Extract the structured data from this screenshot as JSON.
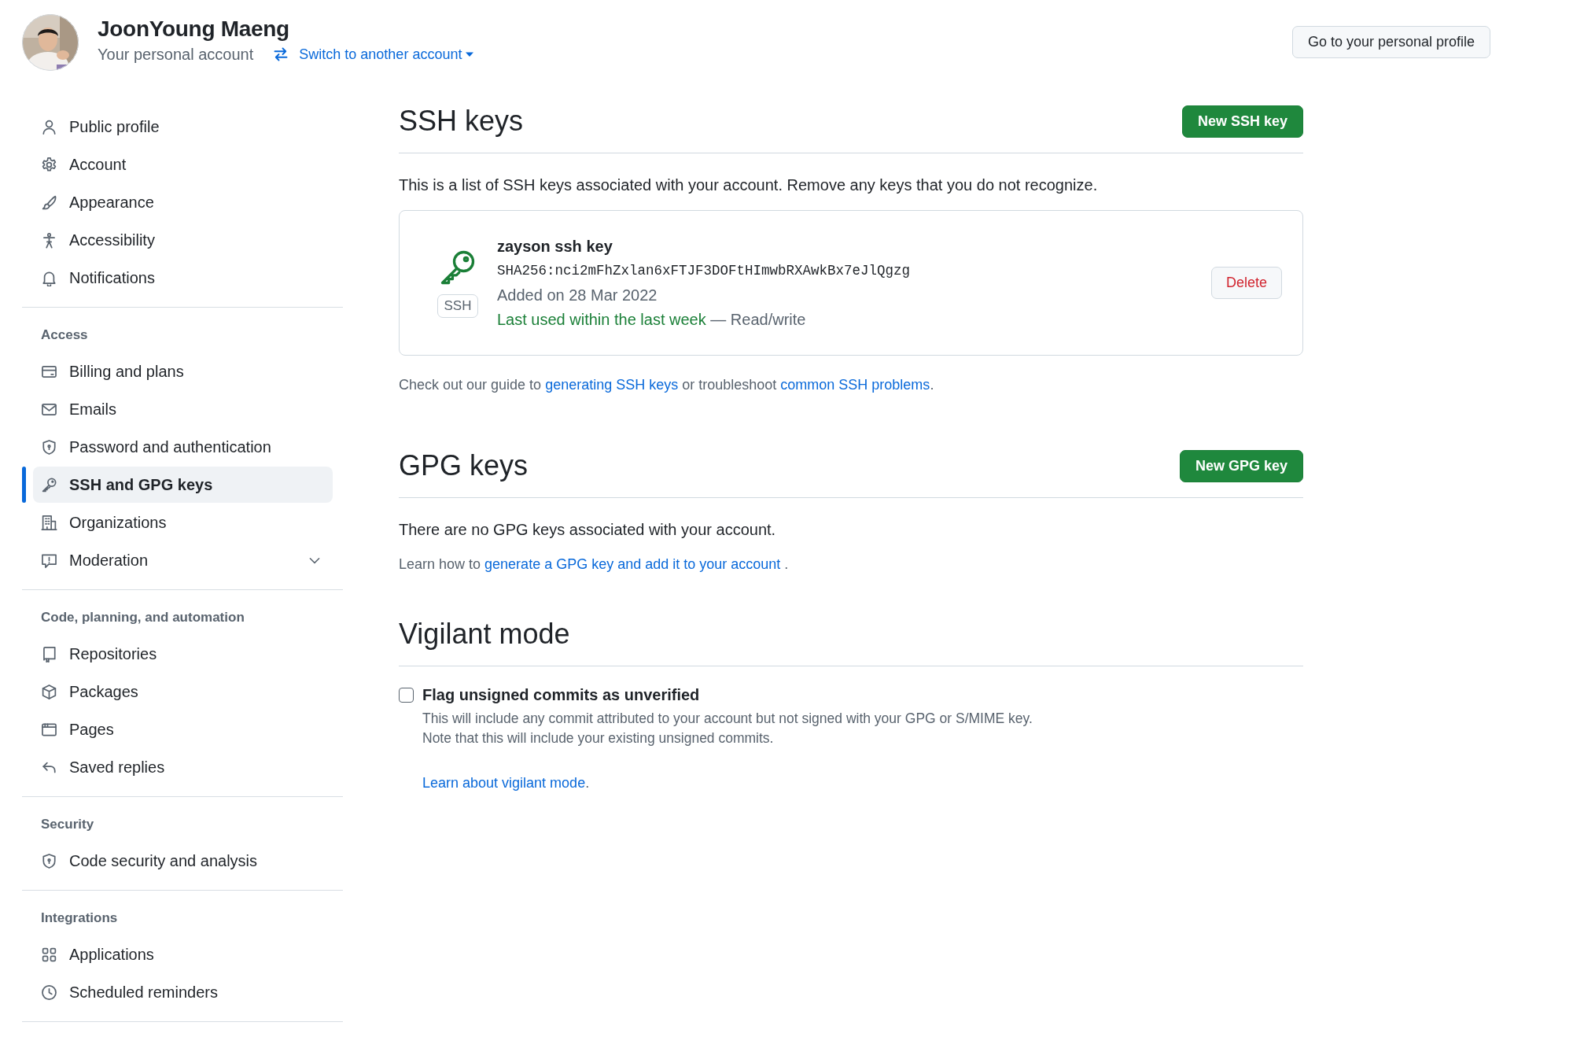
{
  "header": {
    "name": "JoonYoung Maeng",
    "subtitle": "Your personal account",
    "switch_link": "Switch to another account",
    "profile_button": "Go to your personal profile"
  },
  "sidebar": {
    "groups": [
      {
        "items": [
          {
            "label": "Public profile",
            "selected": false
          },
          {
            "label": "Account",
            "selected": false
          },
          {
            "label": "Appearance",
            "selected": false
          },
          {
            "label": "Accessibility",
            "selected": false
          },
          {
            "label": "Notifications",
            "selected": false
          }
        ]
      },
      {
        "heading": "Access",
        "items": [
          {
            "label": "Billing and plans",
            "selected": false
          },
          {
            "label": "Emails",
            "selected": false
          },
          {
            "label": "Password and authentication",
            "selected": false
          },
          {
            "label": "SSH and GPG keys",
            "selected": true
          },
          {
            "label": "Organizations",
            "selected": false
          },
          {
            "label": "Moderation",
            "selected": false,
            "expanded": false
          }
        ]
      },
      {
        "heading": "Code, planning, and automation",
        "items": [
          {
            "label": "Repositories",
            "selected": false
          },
          {
            "label": "Packages",
            "selected": false
          },
          {
            "label": "Pages",
            "selected": false
          },
          {
            "label": "Saved replies",
            "selected": false
          }
        ]
      },
      {
        "heading": "Security",
        "items": [
          {
            "label": "Code security and analysis",
            "selected": false
          }
        ]
      },
      {
        "heading": "Integrations",
        "items": [
          {
            "label": "Applications",
            "selected": false
          },
          {
            "label": "Scheduled reminders",
            "selected": false
          }
        ]
      }
    ]
  },
  "ssh": {
    "title": "SSH keys",
    "button": "New SSH key",
    "description": "This is a list of SSH keys associated with your account. Remove any keys that you do not recognize.",
    "keys": [
      {
        "title": "zayson ssh key",
        "badge": "SSH",
        "fingerprint": "SHA256:nci2mFhZxlan6xFTJF3DOFtHImwbRXAwkBx7eJlQgzg",
        "added": "Added on 28 Mar 2022",
        "last_used": "Last used within the last week",
        "access": " — Read/write",
        "action": "Delete"
      }
    ],
    "guide": [
      {
        "text": "Check out our guide to ",
        "kind": "text"
      },
      {
        "text": "generating SSH keys",
        "kind": "link"
      },
      {
        "text": " or troubleshoot ",
        "kind": "text"
      },
      {
        "text": "common SSH problems",
        "kind": "link"
      },
      {
        "text": ".",
        "kind": "text"
      }
    ]
  },
  "gpg": {
    "title": "GPG keys",
    "button": "New GPG key",
    "empty_text": "There are no GPG keys associated with your account.",
    "guide": [
      {
        "text": "Learn how to ",
        "kind": "text"
      },
      {
        "text": "generate a GPG key and add it to your account",
        "kind": "link"
      },
      {
        "text": " .",
        "kind": "text"
      }
    ]
  },
  "vigilant": {
    "title": "Vigilant mode",
    "option": {
      "label": "Flag unsigned commits as unverified",
      "checked": false,
      "description_lines": [
        "This will include any commit attributed to your account but not signed with your GPG or S/MIME key.",
        "Note that this will include your existing unsigned commits."
      ]
    },
    "link": [
      {
        "text": "Learn about vigilant mode",
        "kind": "link"
      },
      {
        "text": ".",
        "kind": "text"
      }
    ]
  }
}
